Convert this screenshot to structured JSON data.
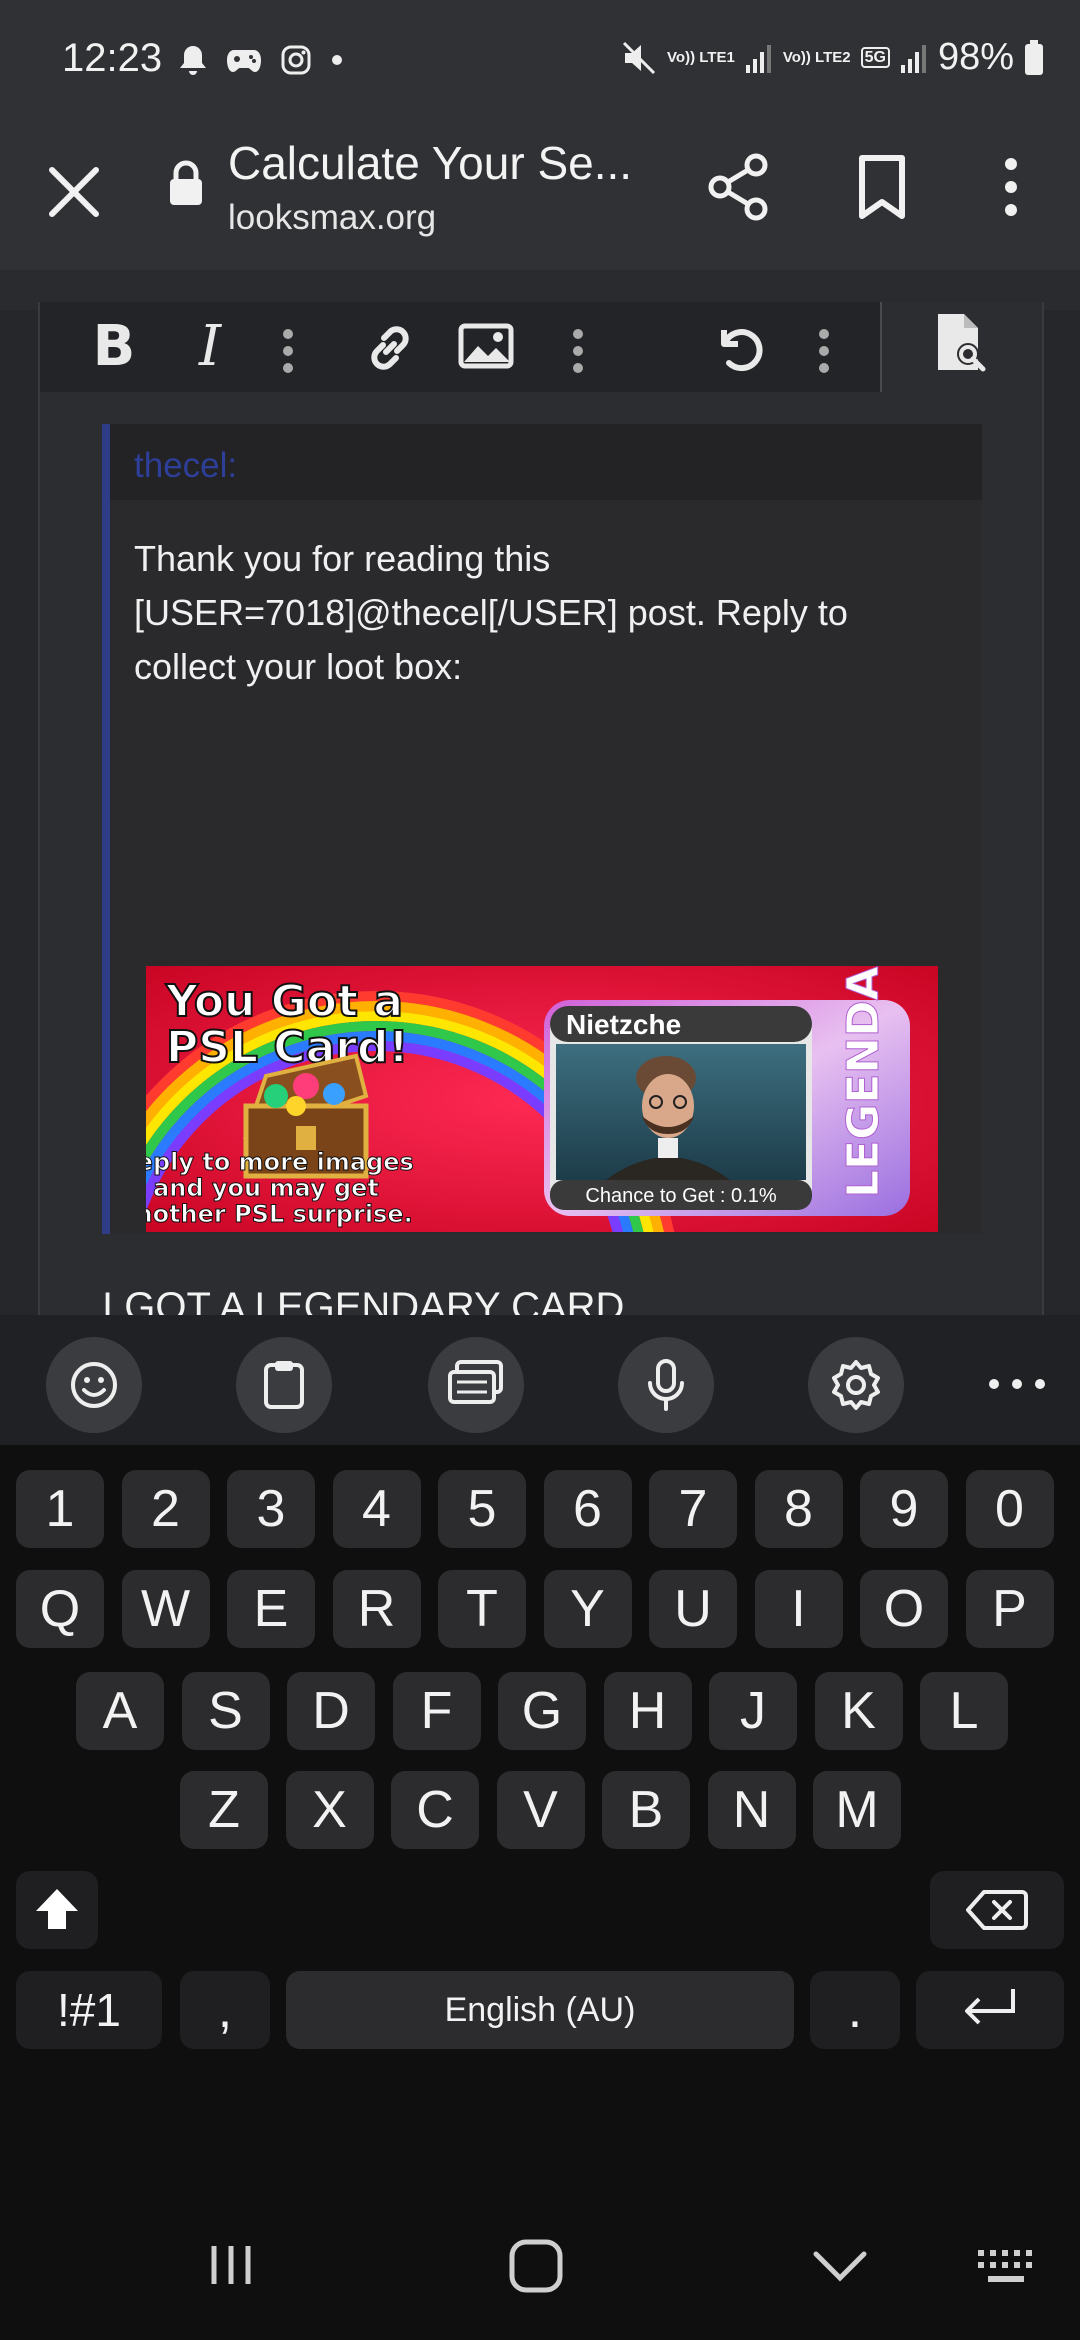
{
  "status_bar": {
    "time": "12:23",
    "network_1": "Vo)) LTE1",
    "network_2": "Vo)) LTE2",
    "badge_5g": "5G",
    "battery": "98%"
  },
  "browser": {
    "page_title": "Calculate Your Se...",
    "url": "looksmax.org"
  },
  "editor": {
    "bold_label": "B",
    "italic_label": "I"
  },
  "quote": {
    "author": "thecel:",
    "body": "Thank you for reading this [USER=7018]@thecel[/USER] post. Reply to collect your loot box:"
  },
  "card_image": {
    "headline_line1": "You Got a",
    "headline_line2": "PSL Card!",
    "caption_line1": "Reply to more images",
    "caption_line2": "and you may get",
    "caption_line3": "another PSL surprise.",
    "card_name": "Nietzche",
    "card_chance": "Chance to Get : 0.1%",
    "rarity": "LEGENDARY"
  },
  "reply": {
    "text": "I GOT A LEGENDARY CARD"
  },
  "keyboard": {
    "number_row": [
      "1",
      "2",
      "3",
      "4",
      "5",
      "6",
      "7",
      "8",
      "9",
      "0"
    ],
    "row_q": [
      "Q",
      "W",
      "E",
      "R",
      "T",
      "Y",
      "U",
      "I",
      "O",
      "P"
    ],
    "row_a": [
      "A",
      "S",
      "D",
      "F",
      "G",
      "H",
      "J",
      "K",
      "L"
    ],
    "row_z": [
      "Z",
      "X",
      "C",
      "V",
      "B",
      "N",
      "M"
    ],
    "symbols_key": "!#1",
    "comma_key": ",",
    "space_label": "English (AU)",
    "period_key": "."
  },
  "colors": {
    "chrome_bg": "#303134",
    "page_bg": "#26272b",
    "quote_border": "#2f3c86",
    "quote_author": "#2d3f99",
    "key_bg": "#2c2c2e"
  }
}
